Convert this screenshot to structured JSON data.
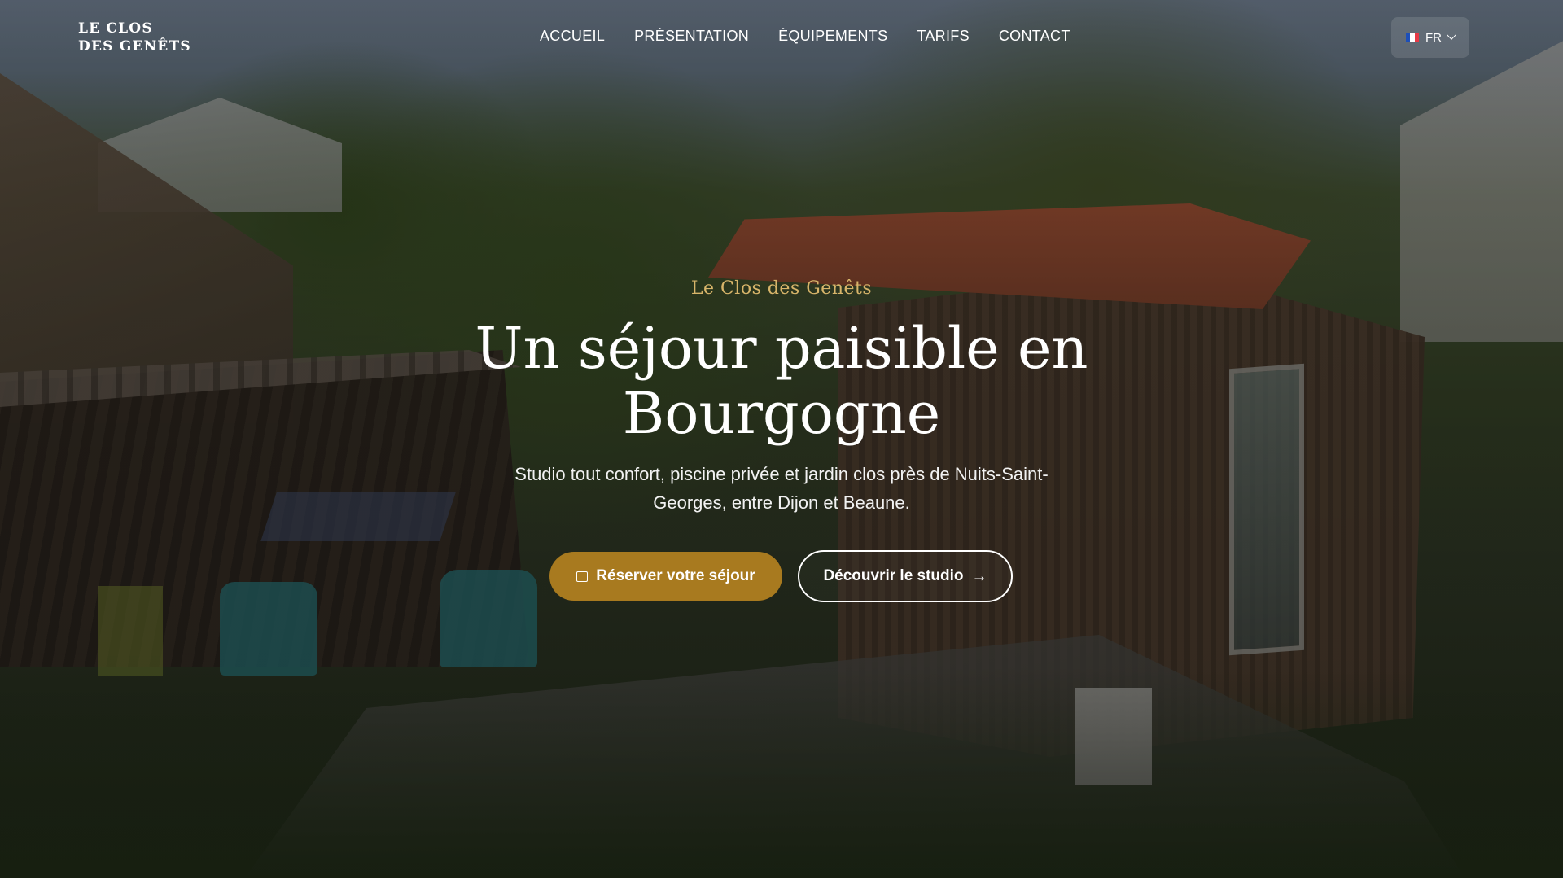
{
  "header": {
    "logo_line1": "LE CLOS",
    "logo_line2": "DES GENÊTS",
    "nav": [
      {
        "label": "ACCUEIL"
      },
      {
        "label": "PRÉSENTATION"
      },
      {
        "label": "ÉQUIPEMENTS"
      },
      {
        "label": "TARIFS"
      },
      {
        "label": "CONTACT"
      }
    ],
    "language": {
      "code": "FR",
      "flag_icon": "france-flag-icon",
      "flag_colors": [
        "#1d4fb8",
        "#ffffff",
        "#e63946"
      ]
    }
  },
  "hero": {
    "eyebrow": "Le Clos des Genêts",
    "title": "Un séjour paisible en Bourgogne",
    "subtitle": "Studio tout confort, piscine privée et jardin clos près de Nuits-Saint-Georges, entre Dijon et Beaune.",
    "primary_button": {
      "label": "Réserver votre séjour",
      "icon": "calendar-icon"
    },
    "secondary_button": {
      "label": "Découvrir le studio",
      "icon": "arrow-right-icon"
    }
  },
  "colors": {
    "accent": "#a87a1f",
    "eyebrow": "#d8b56a"
  }
}
